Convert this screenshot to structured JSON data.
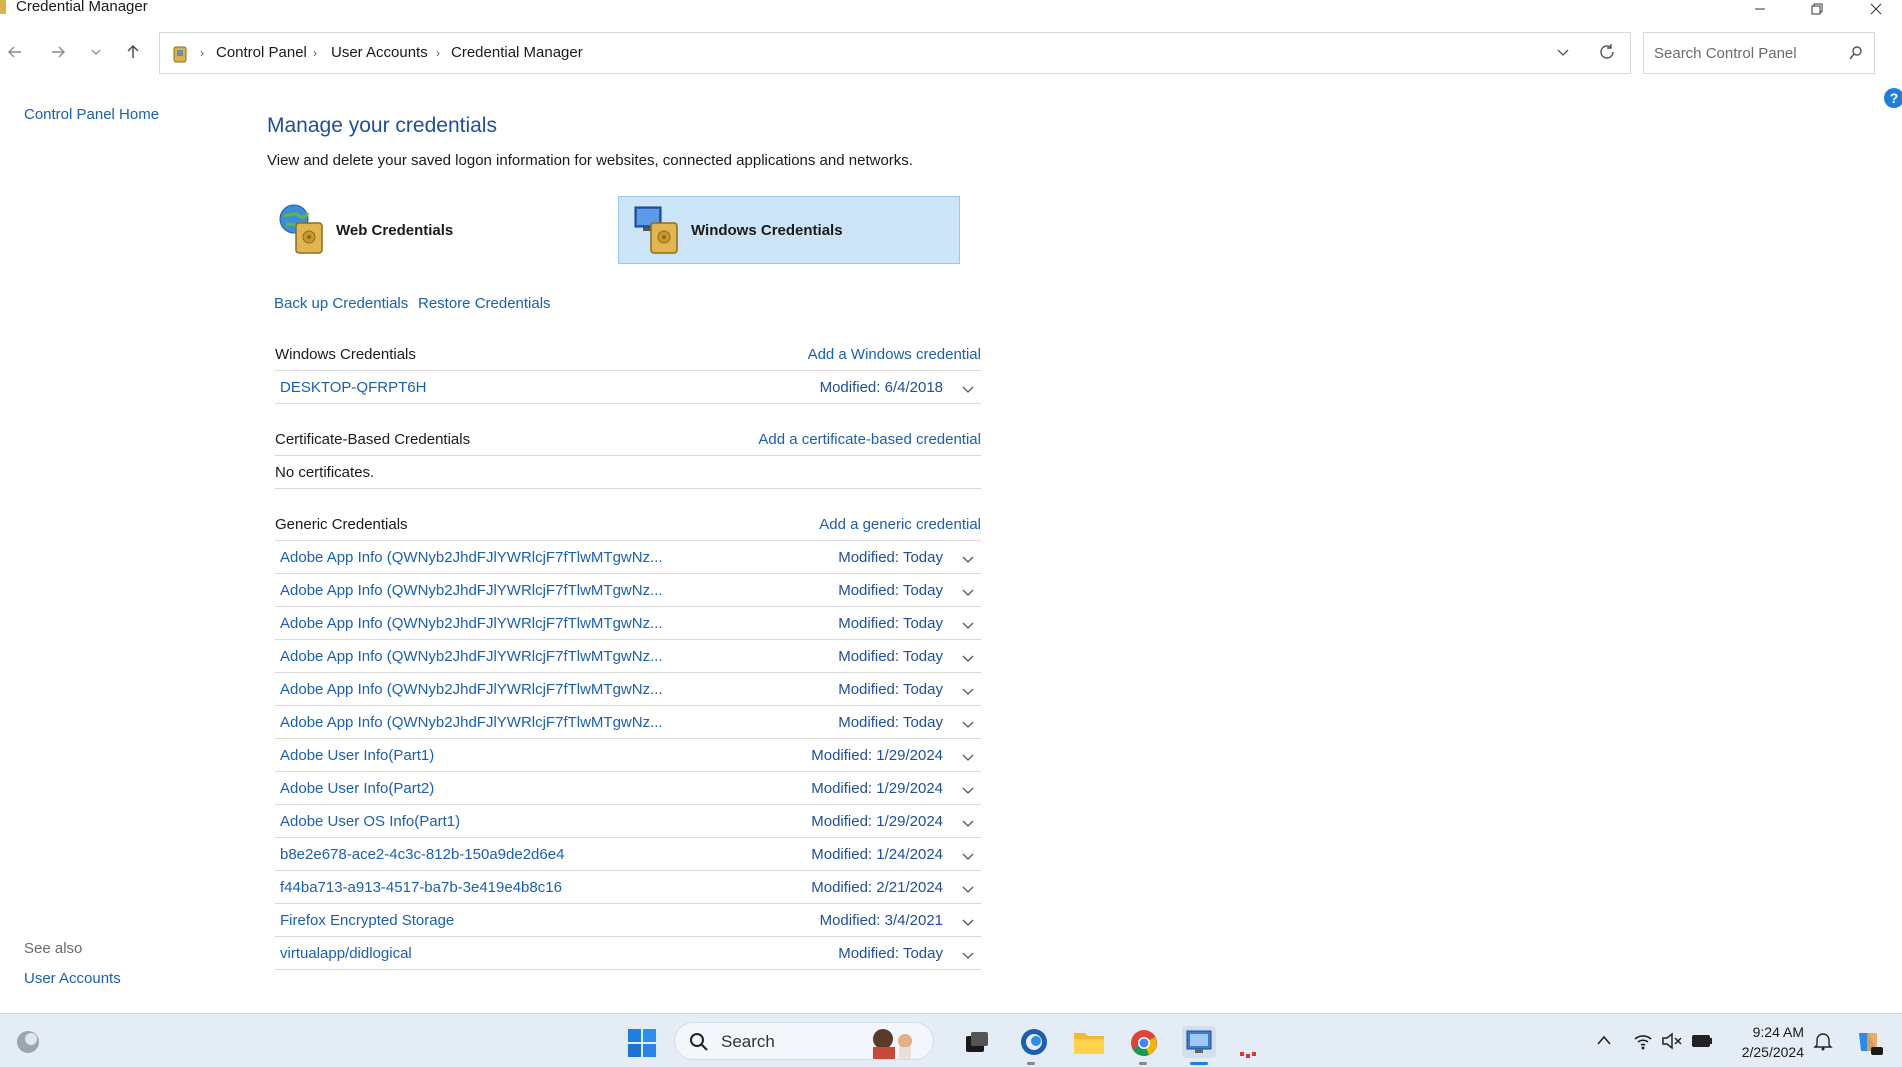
{
  "window": {
    "title": "Credential Manager"
  },
  "address": {
    "crumbs": [
      "Control Panel",
      "User Accounts",
      "Credential Manager"
    ],
    "search_placeholder": "Search Control Panel"
  },
  "left": {
    "home": "Control Panel Home",
    "see_also": "See also",
    "user_accounts": "User Accounts"
  },
  "main": {
    "heading": "Manage your credentials",
    "description": "View and delete your saved logon information for websites, connected applications and networks.",
    "web_credentials": "Web Credentials",
    "windows_credentials": "Windows Credentials",
    "backup": "Back up Credentials",
    "restore": "Restore Credentials"
  },
  "sections": {
    "windows": {
      "title": "Windows Credentials",
      "add": "Add a Windows credential",
      "items": [
        {
          "name": "DESKTOP-QFRPT6H",
          "modified": "Modified:  6/4/2018"
        }
      ]
    },
    "certificate": {
      "title": "Certificate-Based Credentials",
      "add": "Add a certificate-based credential",
      "empty": "No certificates."
    },
    "generic": {
      "title": "Generic Credentials",
      "add": "Add a generic credential",
      "items": [
        {
          "name": "Adobe App Info (QWNyb2JhdFJlYWRlcjF7fTlwMTgwNz...",
          "modified": "Modified:  Today"
        },
        {
          "name": "Adobe App Info (QWNyb2JhdFJlYWRlcjF7fTlwMTgwNz...",
          "modified": "Modified:  Today"
        },
        {
          "name": "Adobe App Info (QWNyb2JhdFJlYWRlcjF7fTlwMTgwNz...",
          "modified": "Modified:  Today"
        },
        {
          "name": "Adobe App Info (QWNyb2JhdFJlYWRlcjF7fTlwMTgwNz...",
          "modified": "Modified:  Today"
        },
        {
          "name": "Adobe App Info (QWNyb2JhdFJlYWRlcjF7fTlwMTgwNz...",
          "modified": "Modified:  Today"
        },
        {
          "name": "Adobe App Info (QWNyb2JhdFJlYWRlcjF7fTlwMTgwNz...",
          "modified": "Modified:  Today"
        },
        {
          "name": "Adobe User Info(Part1)",
          "modified": "Modified:  1/29/2024"
        },
        {
          "name": "Adobe User Info(Part2)",
          "modified": "Modified:  1/29/2024"
        },
        {
          "name": "Adobe User OS Info(Part1)",
          "modified": "Modified:  1/29/2024"
        },
        {
          "name": "b8e2e678-ace2-4c3c-812b-150a9de2d6e4",
          "modified": "Modified:  1/24/2024"
        },
        {
          "name": "f44ba713-a913-4517-ba7b-3e419e4b8c16",
          "modified": "Modified:  2/21/2024"
        },
        {
          "name": "Firefox Encrypted Storage",
          "modified": "Modified:  3/4/2021"
        },
        {
          "name": "virtualapp/didlogical",
          "modified": "Modified:  Today"
        }
      ]
    }
  },
  "taskbar": {
    "search": "Search",
    "time": "9:24 AM",
    "date": "2/25/2024"
  },
  "colors": {
    "link": "#1a5fb4",
    "heading": "#1e4e9e",
    "selected_tile": "#cce4f7",
    "taskbar": "#e4ecf5"
  }
}
